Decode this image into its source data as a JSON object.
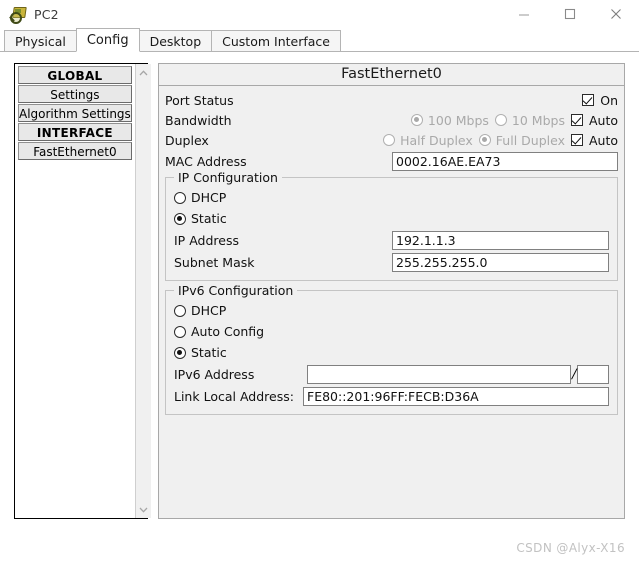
{
  "window": {
    "title": "PC2",
    "icon": "pc-device-icon",
    "controls": {
      "minimize": "minimize-icon",
      "maximize": "maximize-icon",
      "close": "close-icon"
    }
  },
  "tabs": [
    {
      "label": "Physical",
      "active": false
    },
    {
      "label": "Config",
      "active": true
    },
    {
      "label": "Desktop",
      "active": false
    },
    {
      "label": "Custom Interface",
      "active": false
    }
  ],
  "sidebar": {
    "items": [
      {
        "label": "GLOBAL",
        "type": "header"
      },
      {
        "label": "Settings",
        "type": "item"
      },
      {
        "label": "Algorithm Settings",
        "type": "item"
      },
      {
        "label": "INTERFACE",
        "type": "header"
      },
      {
        "label": "FastEthernet0",
        "type": "item"
      }
    ],
    "scrollbar": {
      "up_icon": "chevron-up-icon",
      "down_icon": "chevron-down-icon"
    }
  },
  "panel": {
    "header": "FastEthernet0",
    "port_status": {
      "label": "Port Status",
      "on_label": "On",
      "on_checked": true
    },
    "bandwidth": {
      "label": "Bandwidth",
      "options": [
        {
          "label": "100 Mbps",
          "selected": true,
          "disabled": true
        },
        {
          "label": "10 Mbps",
          "selected": false,
          "disabled": true
        }
      ],
      "auto_label": "Auto",
      "auto_checked": true
    },
    "duplex": {
      "label": "Duplex",
      "options": [
        {
          "label": "Half Duplex",
          "selected": false,
          "disabled": true
        },
        {
          "label": "Full Duplex",
          "selected": true,
          "disabled": true
        }
      ],
      "auto_label": "Auto",
      "auto_checked": true
    },
    "mac": {
      "label": "MAC Address",
      "value": "0002.16AE.EA73"
    },
    "ip_config": {
      "title": "IP Configuration",
      "modes": [
        {
          "label": "DHCP",
          "selected": false
        },
        {
          "label": "Static",
          "selected": true
        }
      ],
      "ip_address": {
        "label": "IP Address",
        "value": "192.1.1.3"
      },
      "subnet_mask": {
        "label": "Subnet Mask",
        "value": "255.255.255.0"
      }
    },
    "ipv6_config": {
      "title": "IPv6 Configuration",
      "modes": [
        {
          "label": "DHCP",
          "selected": false
        },
        {
          "label": "Auto Config",
          "selected": false
        },
        {
          "label": "Static",
          "selected": true
        }
      ],
      "ipv6_address": {
        "label": "IPv6 Address",
        "value": "",
        "separator": "/",
        "prefix_value": ""
      },
      "link_local": {
        "label": "Link Local Address:",
        "value": "FE80::201:96FF:FECB:D36A"
      }
    }
  },
  "watermark": "CSDN @Alyx-X16"
}
